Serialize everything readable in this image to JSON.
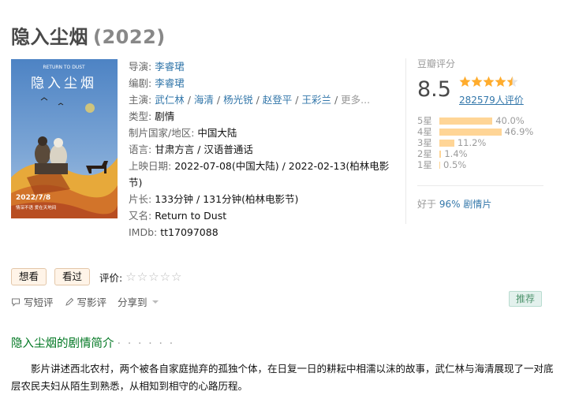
{
  "movie": {
    "title": "隐入尘烟",
    "year": "(2022)"
  },
  "poster": {
    "top_text": "RETURN TO DUST",
    "title_glyphs": "隐入尘烟",
    "date": "2022/7/8",
    "tagline": "情深不语 爱在天地间"
  },
  "info": {
    "director_label": "导演",
    "director": "李睿珺",
    "writer_label": "编剧",
    "writer": "李睿珺",
    "cast_label": "主演",
    "cast": [
      "武仁林",
      "海清",
      "杨光锐",
      "赵登平",
      "王彩兰"
    ],
    "cast_more": "更多...",
    "genre_label": "类型:",
    "genre": "剧情",
    "country_label": "制片国家/地区:",
    "country": "中国大陆",
    "language_label": "语言:",
    "language": "甘肃方言 / 汉语普通话",
    "release_label": "上映日期:",
    "release": "2022-07-08(中国大陆) / 2022-02-13(柏林电影节)",
    "runtime_label": "片长:",
    "runtime": "133分钟 / 131分钟(柏林电影节)",
    "aka_label": "又名:",
    "aka": "Return to Dust",
    "imdb_label": "IMDb:",
    "imdb": "tt17097088"
  },
  "rating": {
    "label": "豆瓣评分",
    "score": "8.5",
    "stars_value": 4.5,
    "count": "282579人评价",
    "breakdown": [
      {
        "label": "5星",
        "pct": "40.0%",
        "value": 40.0
      },
      {
        "label": "4星",
        "pct": "46.9%",
        "value": 46.9
      },
      {
        "label": "3星",
        "pct": "11.2%",
        "value": 11.2
      },
      {
        "label": "2星",
        "pct": "1.4%",
        "value": 1.4
      },
      {
        "label": "1星",
        "pct": "0.5%",
        "value": 0.5
      }
    ],
    "better_prefix": "好于",
    "better_link": "96% 剧情片"
  },
  "actions": {
    "want": "想看",
    "seen": "看过",
    "rate_label": "评价:",
    "rate_stars": "☆☆☆☆☆"
  },
  "links": {
    "short_review": "写短评",
    "review": "写影评",
    "share": "分享到",
    "recommend": "推荐"
  },
  "synopsis": {
    "title": "隐入尘烟的剧情简介",
    "dots": "· · · · · ·",
    "text": "影片讲述西北农村，两个被各自家庭抛弃的孤独个体，在日复一日的耕耘中相濡以沫的故事，武仁林与海清展现了一对底层农民夫妇从陌生到熟悉，从相知到相守的心路历程。"
  },
  "colors": {
    "link": "#3377aa",
    "star": "#ffac2d",
    "bar": "#ffd596",
    "green": "#007722"
  }
}
